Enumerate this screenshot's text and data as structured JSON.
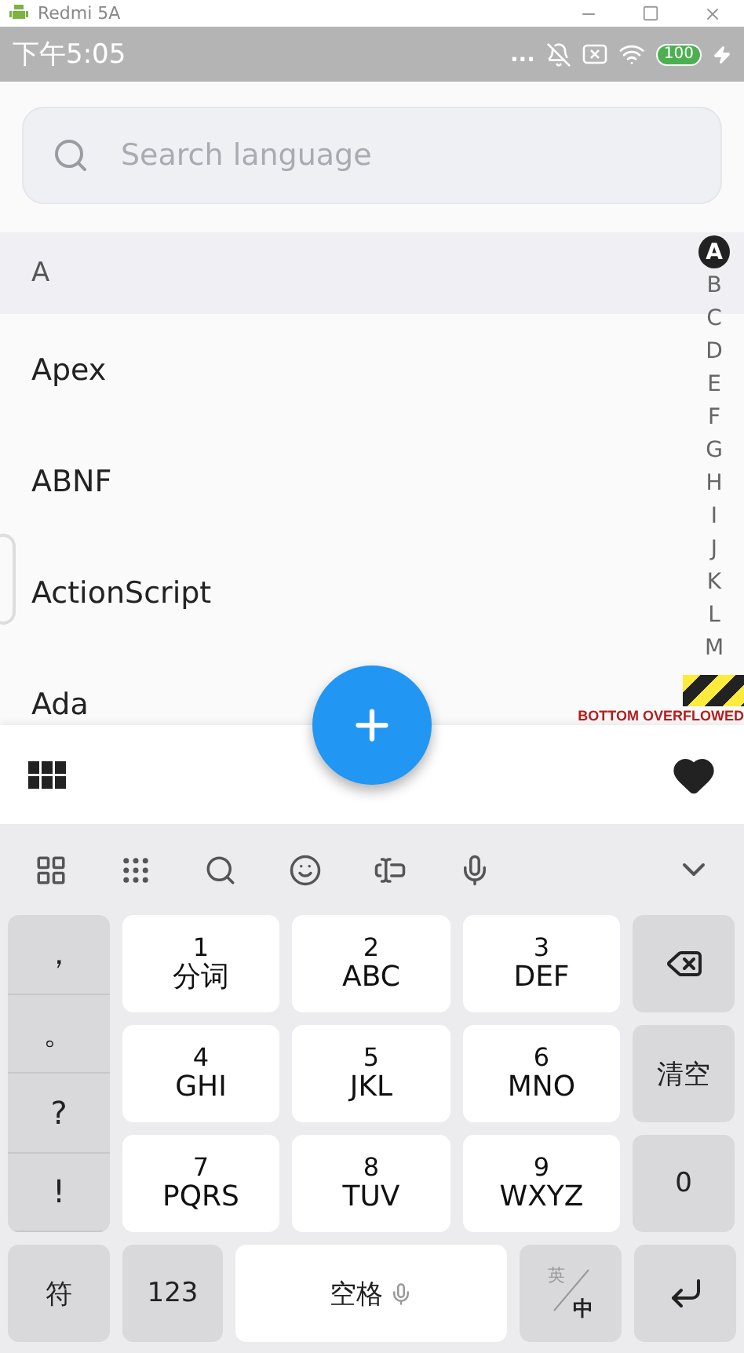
{
  "title_bar": {
    "title": "Redmi 5A"
  },
  "status_bar": {
    "time": "下午5:05",
    "dots": "...",
    "battery": "100"
  },
  "search": {
    "placeholder": "Search language"
  },
  "sections": [
    {
      "header": "A",
      "items": [
        "Apex",
        "ABNF",
        "ActionScript",
        "Ada"
      ]
    }
  ],
  "index": [
    {
      "letter": "A",
      "selected": true
    },
    {
      "letter": "B",
      "selected": false
    },
    {
      "letter": "C",
      "selected": false
    },
    {
      "letter": "D",
      "selected": false
    },
    {
      "letter": "E",
      "selected": false
    },
    {
      "letter": "F",
      "selected": false
    },
    {
      "letter": "G",
      "selected": false
    },
    {
      "letter": "H",
      "selected": false
    },
    {
      "letter": "I",
      "selected": false
    },
    {
      "letter": "J",
      "selected": false
    },
    {
      "letter": "K",
      "selected": false
    },
    {
      "letter": "L",
      "selected": false
    },
    {
      "letter": "M",
      "selected": false
    }
  ],
  "overflow_warning": "BOTTOM OVERFLOWED",
  "keyboard": {
    "punctuation": [
      "，",
      "。",
      "?",
      "!"
    ],
    "keys": [
      {
        "digit": "1",
        "letters": "分词"
      },
      {
        "digit": "2",
        "letters": "ABC"
      },
      {
        "digit": "3",
        "letters": "DEF"
      },
      {
        "digit": "4",
        "letters": "GHI"
      },
      {
        "digit": "5",
        "letters": "JKL"
      },
      {
        "digit": "6",
        "letters": "MNO"
      },
      {
        "digit": "7",
        "letters": "PQRS"
      },
      {
        "digit": "8",
        "letters": "TUV"
      },
      {
        "digit": "9",
        "letters": "WXYZ"
      }
    ],
    "side_keys": [
      {
        "kind": "backspace"
      },
      {
        "kind": "text",
        "label": "清空"
      },
      {
        "kind": "text",
        "label": "0"
      }
    ],
    "bottom_row": [
      {
        "kind": "text",
        "label": "符"
      },
      {
        "kind": "text",
        "label": "123"
      },
      {
        "kind": "space",
        "label": "空格"
      },
      {
        "kind": "lang",
        "top": "英",
        "bottom": "中"
      },
      {
        "kind": "enter"
      }
    ]
  }
}
